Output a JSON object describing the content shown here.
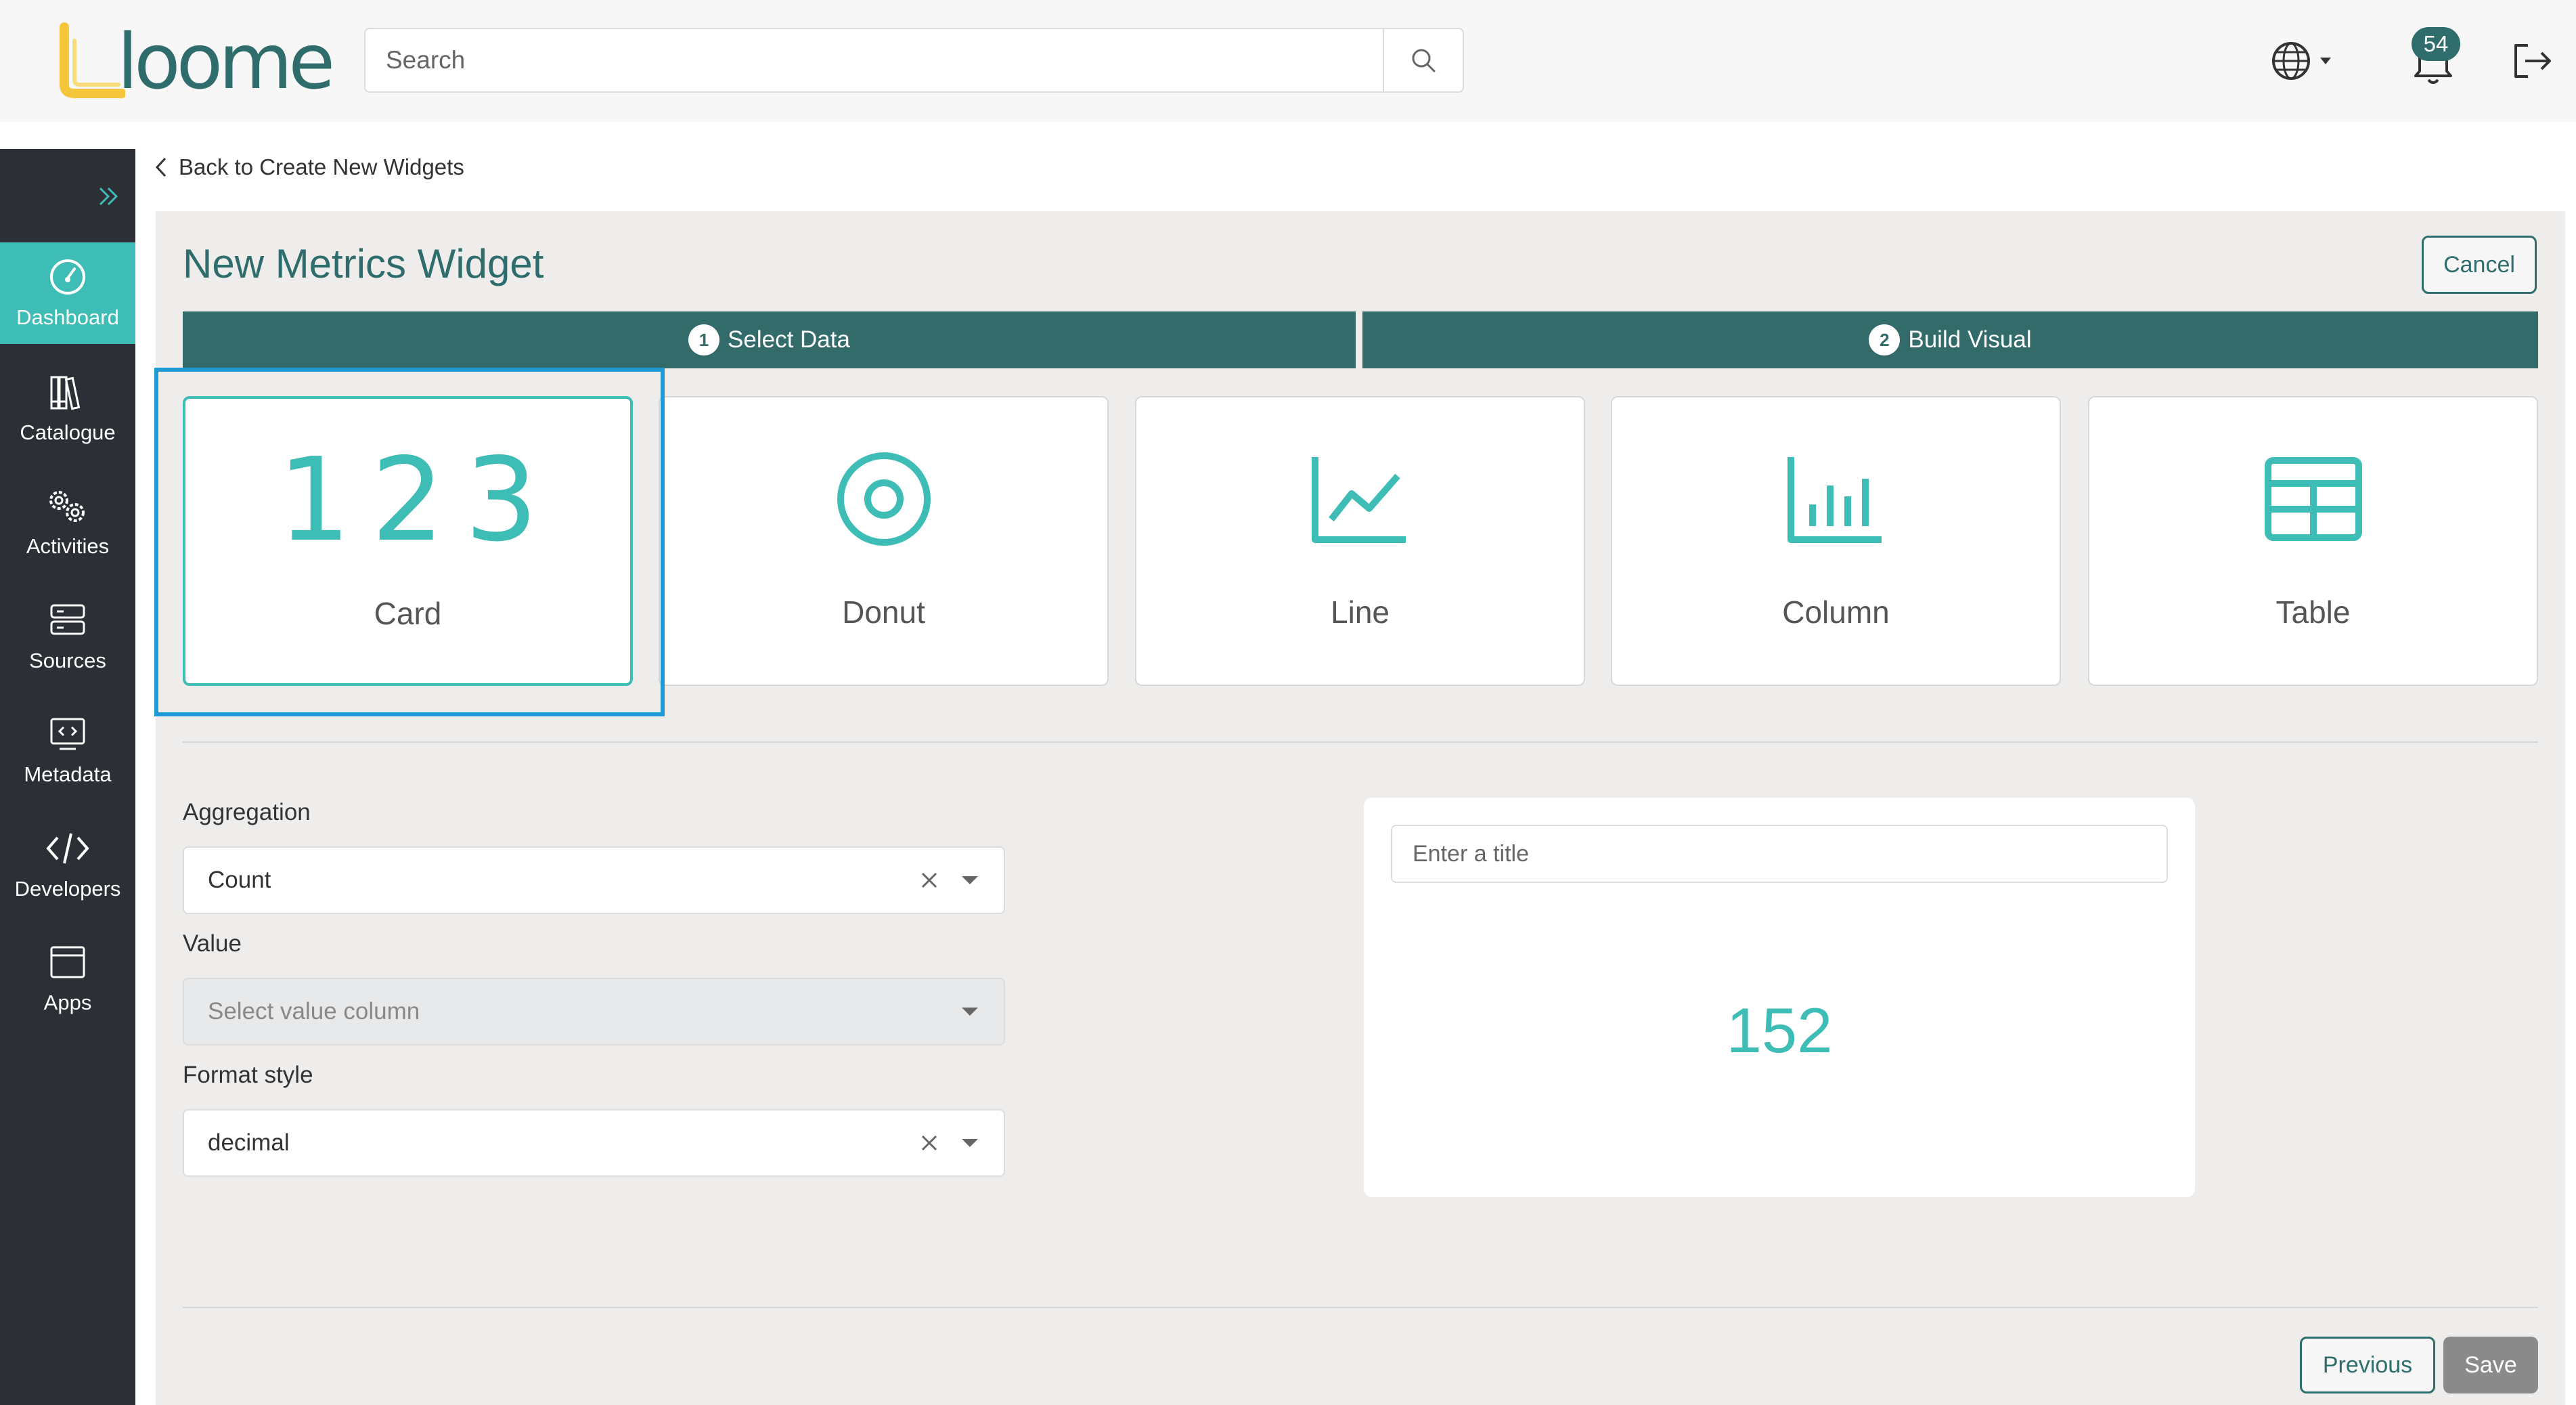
{
  "header": {
    "logo_text": "loome",
    "search_placeholder": "Search",
    "notification_count": "54",
    "icons": [
      "search-icon",
      "globe-icon",
      "bell-icon",
      "logout-icon"
    ]
  },
  "sidebar": {
    "toggle_icon": "double-chevron-right-icon",
    "items": [
      {
        "label": "Dashboard",
        "icon": "dashboard-gauge-icon",
        "active": true
      },
      {
        "label": "Catalogue",
        "icon": "books-icon"
      },
      {
        "label": "Activities",
        "icon": "gears-icon"
      },
      {
        "label": "Sources",
        "icon": "server-icon"
      },
      {
        "label": "Metadata",
        "icon": "code-screen-icon"
      },
      {
        "label": "Developers",
        "icon": "code-brackets-icon"
      },
      {
        "label": "Apps",
        "icon": "window-icon"
      }
    ]
  },
  "back_link": "Back to Create New Widgets",
  "page": {
    "title": "New Metrics Widget",
    "cancel_label": "Cancel",
    "steps": [
      {
        "num": "1",
        "label": "Select Data"
      },
      {
        "num": "2",
        "label": "Build Visual"
      }
    ],
    "widget_types": [
      {
        "label": "Card",
        "glyph": "123",
        "selected": true
      },
      {
        "label": "Donut",
        "icon": "donut-icon"
      },
      {
        "label": "Line",
        "icon": "line-chart-icon"
      },
      {
        "label": "Column",
        "icon": "column-chart-icon"
      },
      {
        "label": "Table",
        "icon": "table-icon"
      }
    ]
  },
  "form": {
    "aggregation": {
      "label": "Aggregation",
      "value": "Count"
    },
    "value": {
      "label": "Value",
      "placeholder": "Select value column"
    },
    "format_style": {
      "label": "Format style",
      "value": "decimal"
    }
  },
  "preview": {
    "title_placeholder": "Enter a title",
    "metric_value": "152"
  },
  "footer": {
    "previous_label": "Previous",
    "save_label": "Save"
  },
  "colors": {
    "brand_teal": "#2f6c6c",
    "accent_teal": "#3dbdb5",
    "sidebar_bg": "#2c2f36",
    "selection_blue": "#1e9ad6",
    "logo_yellow": "#f5c63a"
  }
}
